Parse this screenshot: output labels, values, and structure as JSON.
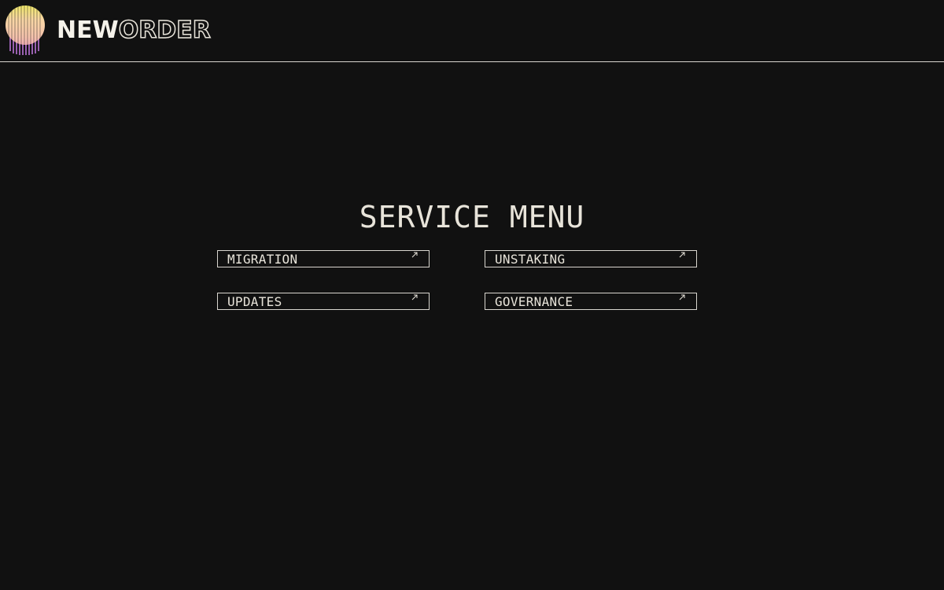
{
  "header": {
    "logo_icon": "neworder-sphere-logo-icon",
    "brand_new": "NEW",
    "brand_order": "ORDER"
  },
  "main": {
    "title": "SERVICE MENU",
    "items": [
      {
        "label": "MIGRATION",
        "icon": "external-arrow-icon"
      },
      {
        "label": "UNSTAKING",
        "icon": "external-arrow-icon"
      },
      {
        "label": "UPDATES",
        "icon": "external-arrow-icon"
      },
      {
        "label": "GOVERNANCE",
        "icon": "external-arrow-icon"
      }
    ]
  },
  "colors": {
    "background": "#111111",
    "text": "#e8e4da",
    "border": "#d9d6cf",
    "logo_yellow": "#f0e86a",
    "logo_peach": "#f6c7a8",
    "logo_purple": "#c77be6"
  }
}
